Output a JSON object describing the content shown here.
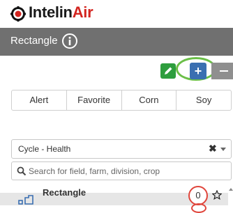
{
  "brand": {
    "name_part1": "Intelin",
    "name_part2": "Air",
    "icon": "intelinair-logo-icon"
  },
  "header": {
    "title": "Rectangle",
    "info_icon": "info-icon"
  },
  "toolbar": {
    "edit_icon": "pencil-icon",
    "add_label": "+",
    "remove_icon": "minus-icon"
  },
  "filter_tabs": [
    "Alert",
    "Favorite",
    "Corn",
    "Soy"
  ],
  "cycle_select": {
    "value": "Cycle - Health",
    "clear_label": "✖"
  },
  "search": {
    "placeholder": "Search for field, farm, division, crop",
    "value": ""
  },
  "list": {
    "items": [
      {
        "title": "Rectangle",
        "count": "0",
        "icon": "field-shapes-icon",
        "favorite_icon": "star-outline-icon"
      }
    ]
  },
  "colors": {
    "header_bg": "#707070",
    "brand_red": "#d3241f",
    "edit_green": "#2e9e3e",
    "add_blue": "#3a6fb1",
    "annotation_green": "#6bbf48",
    "annotation_red": "#e0453b"
  }
}
